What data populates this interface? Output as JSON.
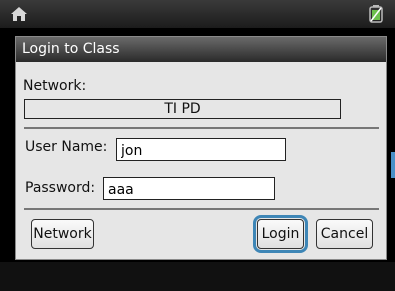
{
  "status_bar": {
    "home_icon": "home-icon",
    "battery_icon": "battery-icon"
  },
  "dialog": {
    "title": "Login to Class",
    "network_label": "Network:",
    "network_value": "TI PD",
    "username_label": "User Name:",
    "username_value": "jon",
    "password_label": "Password:",
    "password_value": "aaa",
    "buttons": {
      "network": "Network",
      "login": "Login",
      "cancel": "Cancel"
    }
  },
  "colors": {
    "focus_outline": "#3e86b6",
    "dialog_bg": "#e6e6e6",
    "title_bg": "#2a2a2a"
  }
}
